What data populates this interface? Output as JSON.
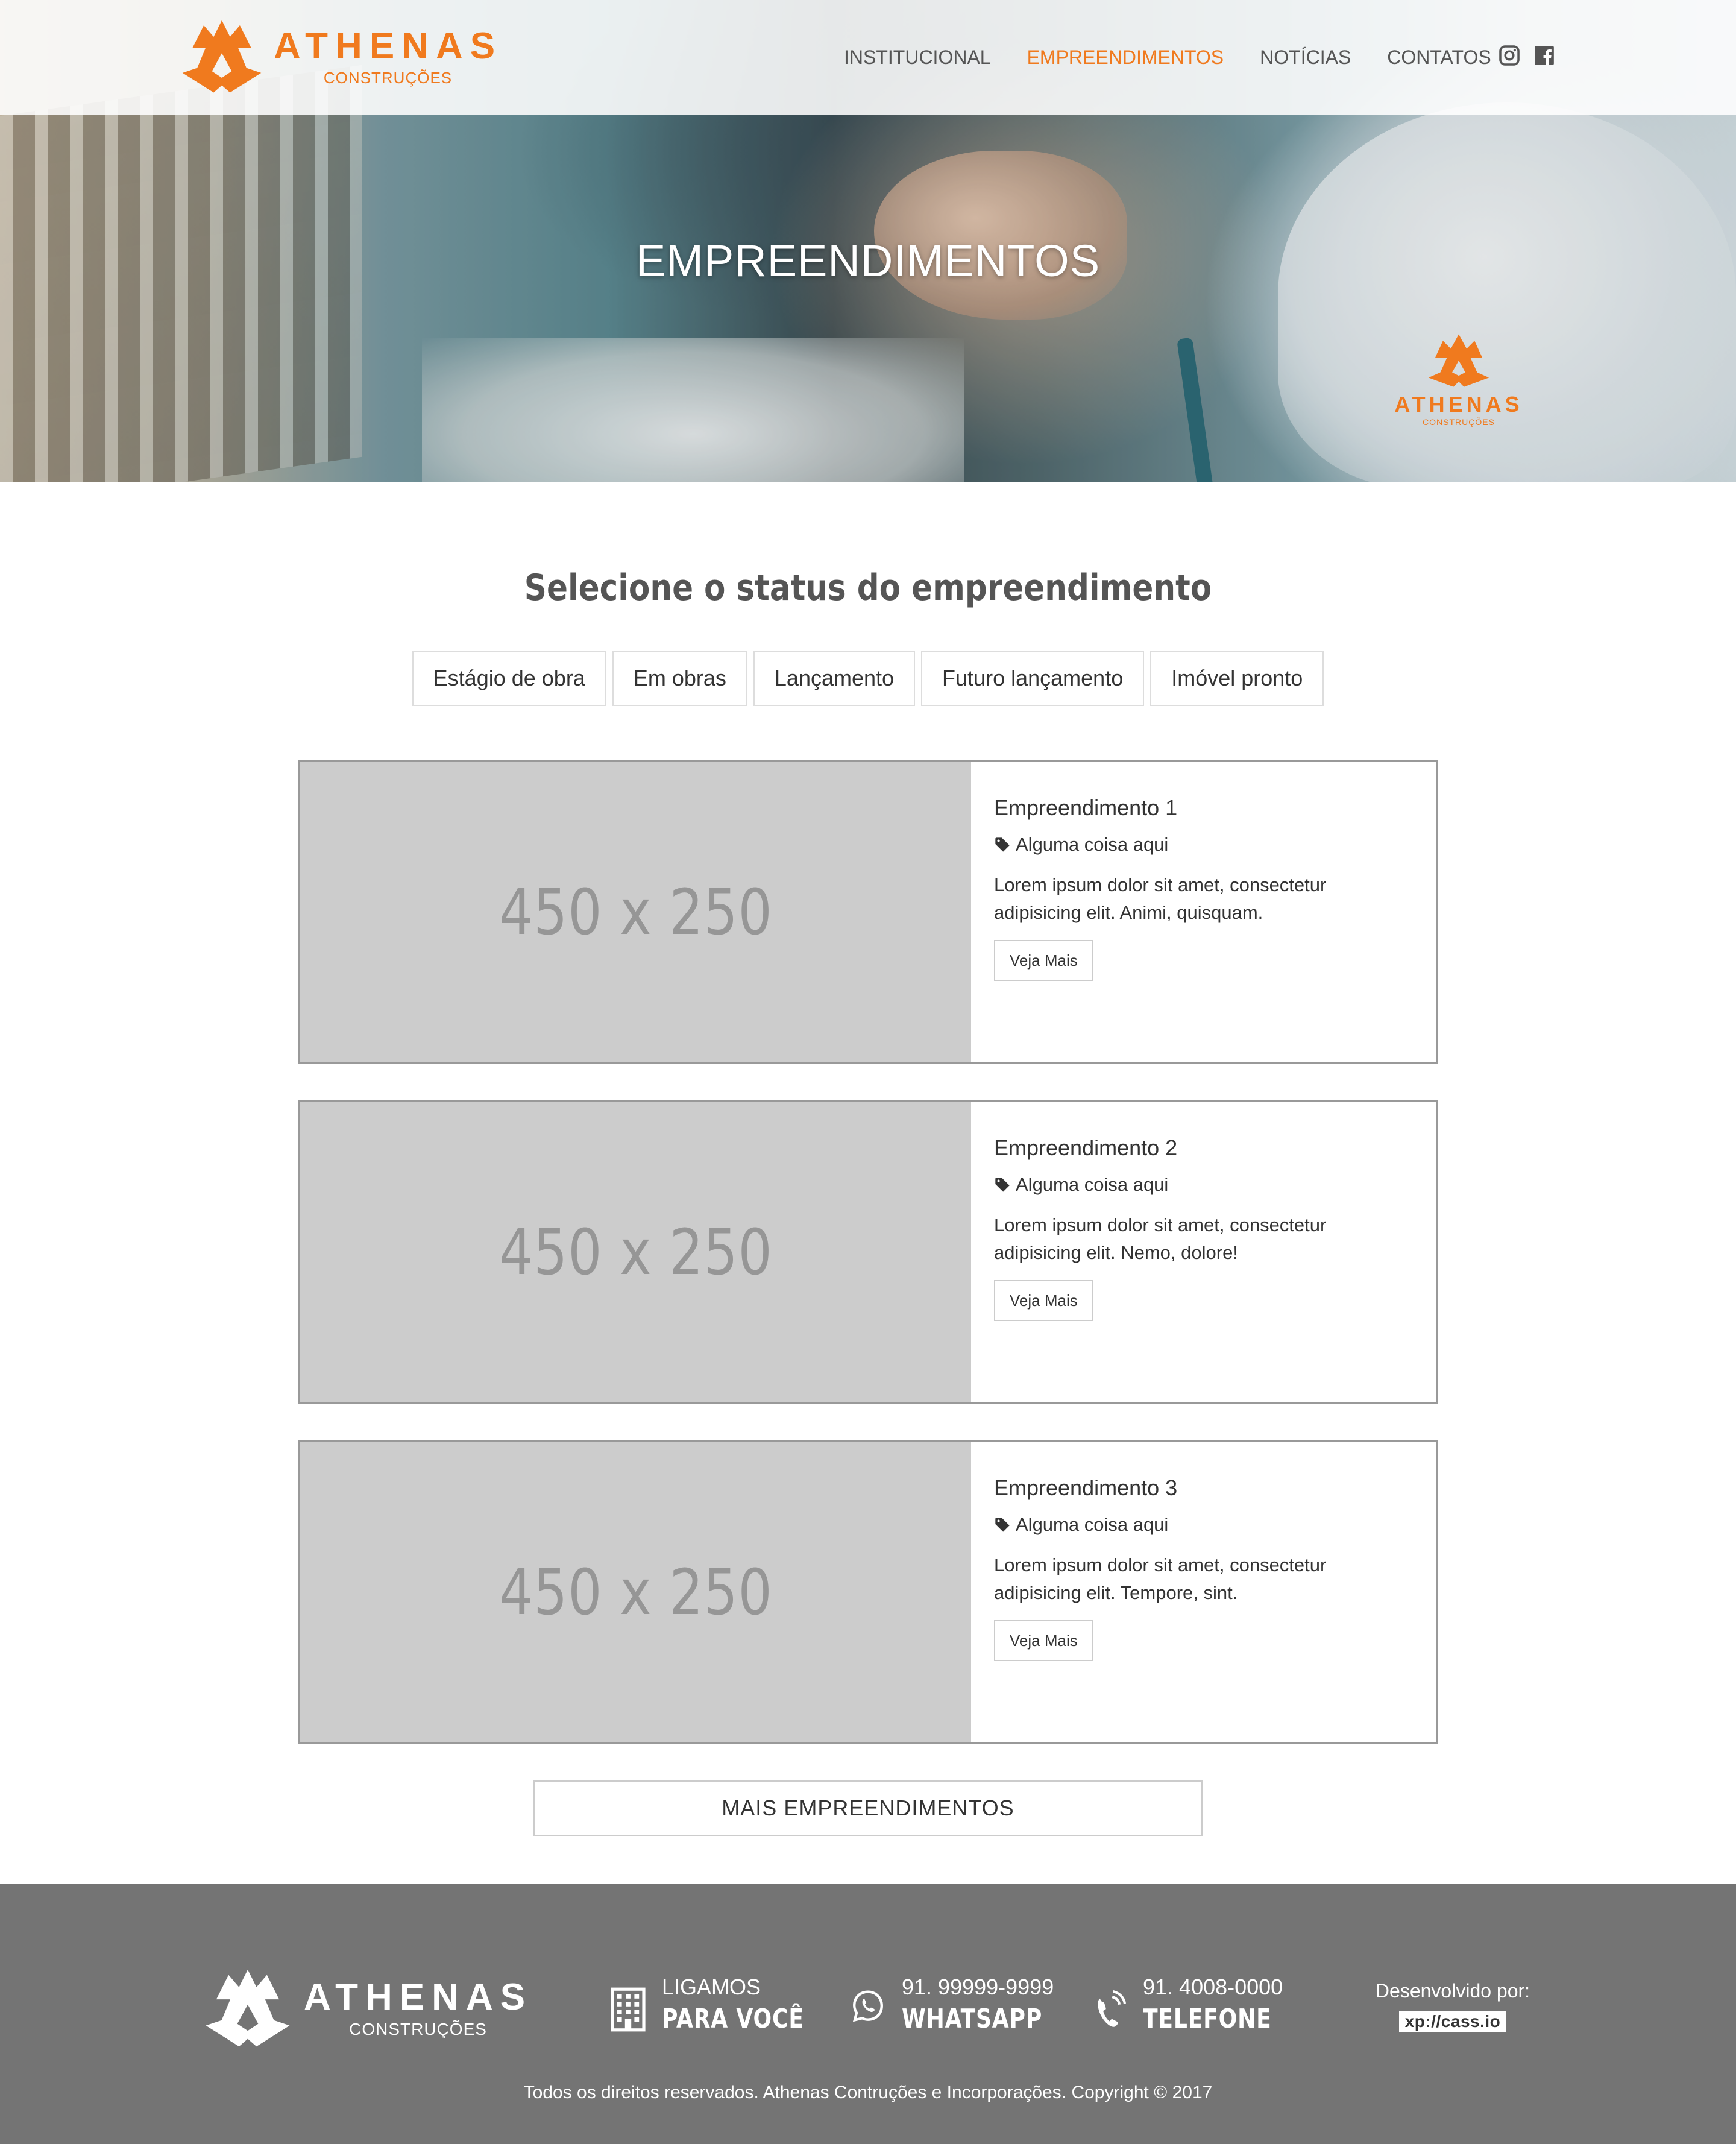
{
  "brand": {
    "name": "ATHENAS",
    "sub": "CONSTRUÇÕES",
    "accent_color": "#f07a1e"
  },
  "nav": {
    "items": [
      {
        "label": "INSTITUCIONAL",
        "active": false
      },
      {
        "label": "EMPREENDIMENTOS",
        "active": true
      },
      {
        "label": "NOTÍCIAS",
        "active": false
      },
      {
        "label": "CONTATOS",
        "active": false
      }
    ],
    "social": [
      "instagram-icon",
      "facebook-icon"
    ]
  },
  "hero": {
    "title": "EMPREENDIMENTOS"
  },
  "status_section": {
    "title": "Selecione o status do empreendimento",
    "filters": [
      "Estágio de obra",
      "Em obras",
      "Lançamento",
      "Futuro lançamento",
      "Imóvel pronto"
    ]
  },
  "cards": [
    {
      "image_placeholder": "450 x 250",
      "title": "Empreendimento 1",
      "tag": "Alguma coisa aqui",
      "text": "Lorem ipsum dolor sit amet, consectetur adipisicing elit. Animi, quisquam.",
      "button": "Veja Mais"
    },
    {
      "image_placeholder": "450 x 250",
      "title": "Empreendimento 2",
      "tag": "Alguma coisa aqui",
      "text": "Lorem ipsum dolor sit amet, consectetur adipisicing elit. Nemo, dolore!",
      "button": "Veja Mais"
    },
    {
      "image_placeholder": "450 x 250",
      "title": "Empreendimento 3",
      "tag": "Alguma coisa aqui",
      "text": "Lorem ipsum dolor sit amet, consectetur adipisicing elit. Tempore, sint.",
      "button": "Veja Mais"
    }
  ],
  "more_button": "MAIS EMPREENDIMENTOS",
  "footer": {
    "contacts": [
      {
        "icon": "building-icon",
        "line1": "LIGAMOS",
        "line2": "PARA VOCÊ"
      },
      {
        "icon": "whatsapp-icon",
        "line1": "91. 99999-9999",
        "line2": "WHATSAPP"
      },
      {
        "icon": "phone-icon",
        "line1": "91. 4008-0000",
        "line2": "TELEFONE"
      }
    ],
    "developer_label": "Desenvolvido por:",
    "developer_name": "xp://cass.io",
    "copyright": "Todos os direitos reservados. Athenas Contruções e Incorporações. Copyright © 2017"
  }
}
